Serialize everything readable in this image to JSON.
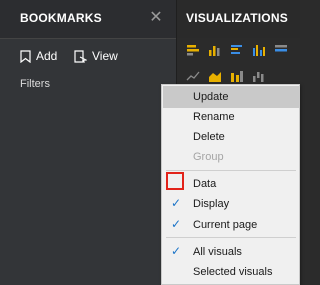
{
  "bookmarks": {
    "title": "BOOKMARKS",
    "close_icon": "close-icon",
    "add_label": "Add",
    "view_label": "View",
    "filters_label": "Filters"
  },
  "visualizations": {
    "title": "VISUALIZATIONS"
  },
  "context_menu": {
    "items": [
      {
        "label": "Update",
        "state": "highlighted"
      },
      {
        "label": "Rename",
        "state": "normal"
      },
      {
        "label": "Delete",
        "state": "normal"
      },
      {
        "label": "Group",
        "state": "disabled"
      },
      {
        "label": "Data",
        "checked": false
      },
      {
        "label": "Display",
        "checked": true
      },
      {
        "label": "Current page",
        "checked": true
      },
      {
        "label": "All visuals",
        "checked": true
      },
      {
        "label": "Selected visuals",
        "checked": false
      }
    ]
  },
  "colors": {
    "accent_check": "#1b74c8",
    "annotation_red": "#e2231a",
    "viz_gold": "#e7b000",
    "viz_blue": "#3a8ee6",
    "viz_grey": "#8a8a8a"
  }
}
